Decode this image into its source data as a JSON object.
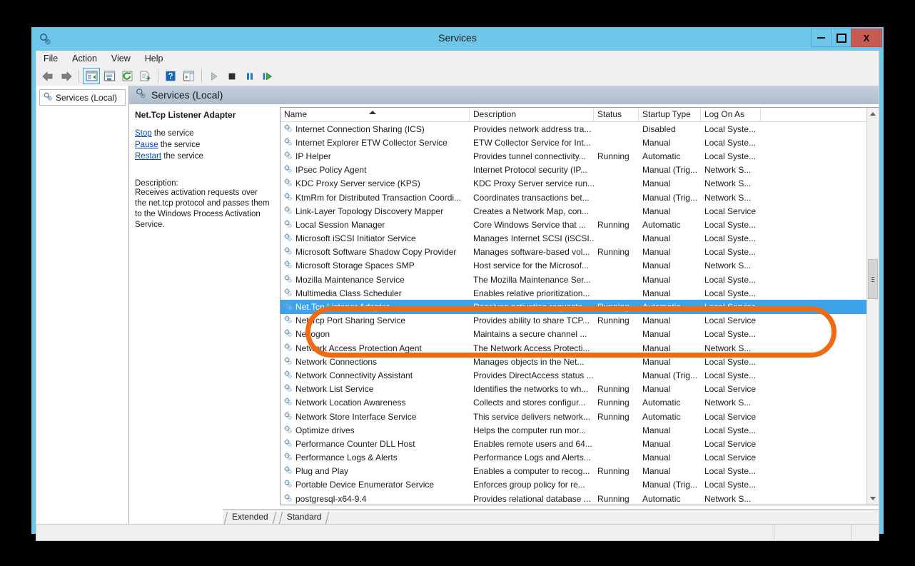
{
  "window": {
    "title": "Services",
    "app_icon": "services-magnifier-gear-icon",
    "minimize_label": "Minimize",
    "maximize_label": "Maximize",
    "close_label": "X"
  },
  "menubar": {
    "items": [
      {
        "label": "File",
        "name": "menu-file"
      },
      {
        "label": "Action",
        "name": "menu-action"
      },
      {
        "label": "View",
        "name": "menu-view"
      },
      {
        "label": "Help",
        "name": "menu-help"
      }
    ]
  },
  "toolbar": {
    "buttons": [
      {
        "name": "back-arrow-icon",
        "tip": "Back"
      },
      {
        "name": "forward-arrow-icon",
        "tip": "Forward"
      },
      {
        "name": "show-hide-console-tree-icon",
        "tip": "Show/Hide Console Tree",
        "active": true
      },
      {
        "name": "properties-icon",
        "tip": "Properties"
      },
      {
        "name": "refresh-icon",
        "tip": "Refresh"
      },
      {
        "name": "export-list-icon",
        "tip": "Export List"
      },
      {
        "name": "help-icon",
        "tip": "Help"
      },
      {
        "name": "show-action-pane-icon",
        "tip": "Show/Hide Action Pane"
      },
      {
        "name": "start-service-icon",
        "tip": "Start Service"
      },
      {
        "name": "stop-service-icon",
        "tip": "Stop Service"
      },
      {
        "name": "pause-service-icon",
        "tip": "Pause Service"
      },
      {
        "name": "restart-service-icon",
        "tip": "Restart Service"
      }
    ]
  },
  "tree": {
    "root_label": "Services (Local)",
    "root_icon": "services-gear-icon"
  },
  "pane": {
    "header_label": "Services (Local)",
    "header_icon": "services-magnifier-gear-icon"
  },
  "detail": {
    "service_title": "Net.Tcp Listener Adapter",
    "actions": [
      {
        "link": "Stop",
        "suffix": " the service"
      },
      {
        "link": "Pause",
        "suffix": " the service"
      },
      {
        "link": "Restart",
        "suffix": " the service"
      }
    ],
    "description_label": "Description:",
    "description_text": "Receives activation requests over the net.tcp protocol and passes them to the Windows Process Activation Service."
  },
  "list": {
    "columns": [
      {
        "label": "Name",
        "key": "name",
        "sorted": "asc"
      },
      {
        "label": "Description",
        "key": "description"
      },
      {
        "label": "Status",
        "key": "status"
      },
      {
        "label": "Startup Type",
        "key": "startup"
      },
      {
        "label": "Log On As",
        "key": "logon"
      }
    ],
    "rows": [
      {
        "name": "Internet Connection Sharing (ICS)",
        "description": "Provides network address tra...",
        "status": "",
        "startup": "Disabled",
        "logon": "Local Syste...",
        "selected": false
      },
      {
        "name": "Internet Explorer ETW Collector Service",
        "description": "ETW Collector Service for Int...",
        "status": "",
        "startup": "Manual",
        "logon": "Local Syste...",
        "selected": false
      },
      {
        "name": "IP Helper",
        "description": "Provides tunnel connectivity...",
        "status": "Running",
        "startup": "Automatic",
        "logon": "Local Syste...",
        "selected": false
      },
      {
        "name": "IPsec Policy Agent",
        "description": "Internet Protocol security (IP...",
        "status": "",
        "startup": "Manual (Trig...",
        "logon": "Network S...",
        "selected": false
      },
      {
        "name": "KDC Proxy Server service (KPS)",
        "description": "KDC Proxy Server service run...",
        "status": "",
        "startup": "Manual",
        "logon": "Network S...",
        "selected": false
      },
      {
        "name": "KtmRm for Distributed Transaction Coordi...",
        "description": "Coordinates transactions bet...",
        "status": "",
        "startup": "Manual (Trig...",
        "logon": "Network S...",
        "selected": false
      },
      {
        "name": "Link-Layer Topology Discovery Mapper",
        "description": "Creates a Network Map, con...",
        "status": "",
        "startup": "Manual",
        "logon": "Local Service",
        "selected": false
      },
      {
        "name": "Local Session Manager",
        "description": "Core Windows Service that ...",
        "status": "Running",
        "startup": "Automatic",
        "logon": "Local Syste...",
        "selected": false
      },
      {
        "name": "Microsoft iSCSI Initiator Service",
        "description": "Manages Internet SCSI (iSCSI...",
        "status": "",
        "startup": "Manual",
        "logon": "Local Syste...",
        "selected": false
      },
      {
        "name": "Microsoft Software Shadow Copy Provider",
        "description": "Manages software-based vol...",
        "status": "Running",
        "startup": "Manual",
        "logon": "Local Syste...",
        "selected": false
      },
      {
        "name": "Microsoft Storage Spaces SMP",
        "description": "Host service for the Microsof...",
        "status": "",
        "startup": "Manual",
        "logon": "Network S...",
        "selected": false
      },
      {
        "name": "Mozilla Maintenance Service",
        "description": "The Mozilla Maintenance Ser...",
        "status": "",
        "startup": "Manual",
        "logon": "Local Syste...",
        "selected": false
      },
      {
        "name": "Multimedia Class Scheduler",
        "description": "Enables relative prioritization...",
        "status": "",
        "startup": "Manual",
        "logon": "Local Syste...",
        "selected": false
      },
      {
        "name": "Net.Tcp Listener Adapter",
        "description": "Receives activation requests ...",
        "status": "Running",
        "startup": "Automatic",
        "logon": "Local Service",
        "selected": true
      },
      {
        "name": "Net.Tcp Port Sharing Service",
        "description": "Provides ability to share TCP...",
        "status": "Running",
        "startup": "Manual",
        "logon": "Local Service",
        "selected": false
      },
      {
        "name": "Netlogon",
        "description": "Maintains a secure channel ...",
        "status": "",
        "startup": "Manual",
        "logon": "Local Syste...",
        "selected": false
      },
      {
        "name": "Network Access Protection Agent",
        "description": "The Network Access Protecti...",
        "status": "",
        "startup": "Manual",
        "logon": "Network S...",
        "selected": false
      },
      {
        "name": "Network Connections",
        "description": "Manages objects in the Net...",
        "status": "",
        "startup": "Manual",
        "logon": "Local Syste...",
        "selected": false
      },
      {
        "name": "Network Connectivity Assistant",
        "description": "Provides DirectAccess status ...",
        "status": "",
        "startup": "Manual (Trig...",
        "logon": "Local Syste...",
        "selected": false
      },
      {
        "name": "Network List Service",
        "description": "Identifies the networks to wh...",
        "status": "Running",
        "startup": "Manual",
        "logon": "Local Service",
        "selected": false
      },
      {
        "name": "Network Location Awareness",
        "description": "Collects and stores configur...",
        "status": "Running",
        "startup": "Automatic",
        "logon": "Network S...",
        "selected": false
      },
      {
        "name": "Network Store Interface Service",
        "description": "This service delivers network...",
        "status": "Running",
        "startup": "Automatic",
        "logon": "Local Service",
        "selected": false
      },
      {
        "name": "Optimize drives",
        "description": "Helps the computer run mor...",
        "status": "",
        "startup": "Manual",
        "logon": "Local Syste...",
        "selected": false
      },
      {
        "name": "Performance Counter DLL Host",
        "description": "Enables remote users and 64...",
        "status": "",
        "startup": "Manual",
        "logon": "Local Service",
        "selected": false
      },
      {
        "name": "Performance Logs & Alerts",
        "description": "Performance Logs and Alerts...",
        "status": "",
        "startup": "Manual",
        "logon": "Local Service",
        "selected": false
      },
      {
        "name": "Plug and Play",
        "description": "Enables a computer to recog...",
        "status": "Running",
        "startup": "Manual",
        "logon": "Local Syste...",
        "selected": false
      },
      {
        "name": "Portable Device Enumerator Service",
        "description": "Enforces group policy for re...",
        "status": "",
        "startup": "Manual (Trig...",
        "logon": "Local Syste...",
        "selected": false
      },
      {
        "name": "postgresql-x64-9.4",
        "description": "Provides relational database ...",
        "status": "Running",
        "startup": "Automatic",
        "logon": "Network S...",
        "selected": false
      }
    ]
  },
  "tabs": [
    {
      "label": "Extended",
      "name": "tab-extended",
      "active": false
    },
    {
      "label": "Standard",
      "name": "tab-standard",
      "active": true
    }
  ],
  "annotation": {
    "color": "#f26a10",
    "shape": "rounded-rectangle-highlight"
  },
  "colors": {
    "title_bar": "#6ec6e8",
    "selection": "#3da4ea",
    "close_button": "#c75b54",
    "link": "#0645ad",
    "pane_header": "#aebdcd"
  }
}
